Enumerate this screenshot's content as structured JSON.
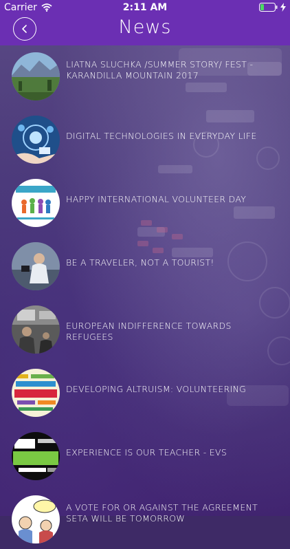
{
  "status_bar": {
    "carrier": "Carrier",
    "time": "2:11 AM"
  },
  "nav": {
    "title": "News",
    "back_icon": "chevron-left-icon"
  },
  "news_items": [
    {
      "title": "LIATNA SLUCHKA /SUMMER STORY/ FEST - KARANDILLA MOUNTAIN 2017",
      "thumb": "mountain-landscape"
    },
    {
      "title": "DIGITAL TECHNOLOGIES IN EVERYDAY LIFE",
      "thumb": "digital-tech"
    },
    {
      "title": "HAPPY INTERNATIONAL VOLUNTEER DAY",
      "thumb": "volunteers-logo"
    },
    {
      "title": "BE A TRAVELER, NOT A TOURIST!",
      "thumb": "traveler-photo"
    },
    {
      "title": "EUROPEAN INDIFFERENCE TOWARDS REFUGEES",
      "thumb": "refugees-photo"
    },
    {
      "title": "DEVELOPING ALTRUISM: VOLUNTEERING",
      "thumb": "volunteer-word-cloud"
    },
    {
      "title": "EXPERIENCE IS OUR TEACHER - EVS",
      "thumb": "life-change-words"
    },
    {
      "title": "A VOTE FOR OR AGAINST THE AGREEMENT SETA WILL BE TOMORROW",
      "thumb": "cartoon-vote"
    }
  ]
}
